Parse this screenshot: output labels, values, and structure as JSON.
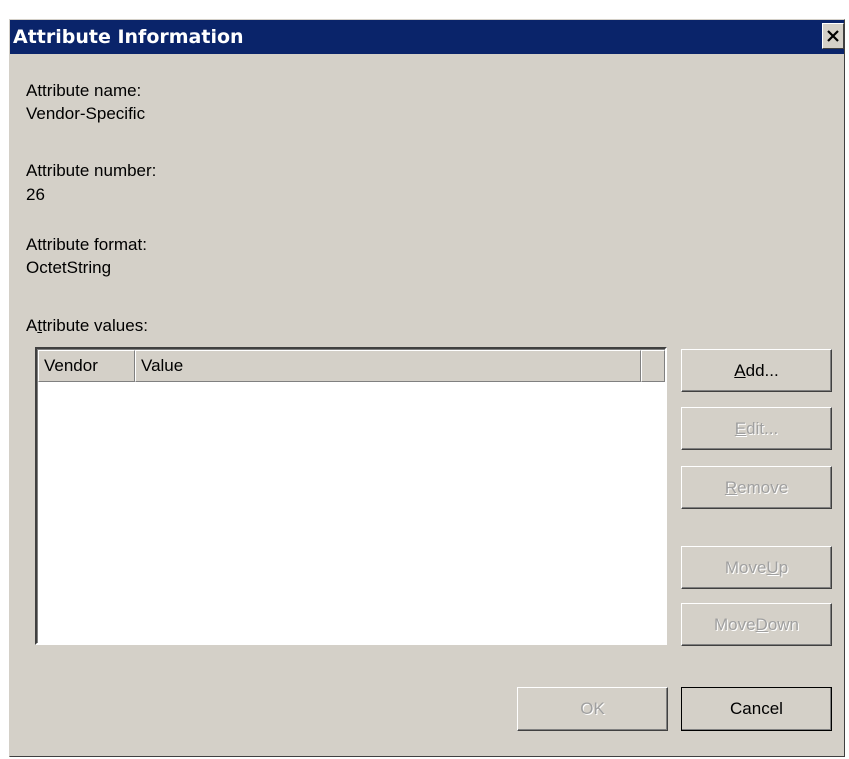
{
  "window": {
    "title": "Attribute Information",
    "close_icon": "close-icon"
  },
  "fields": {
    "name_label": "Attribute name:",
    "name_value": "Vendor-Specific",
    "number_label": "Attribute number:",
    "number_value": "26",
    "format_label": "Attribute format:",
    "format_value": "OctetString",
    "values_label_pre": "A",
    "values_label_mnemonic": "t",
    "values_label_post": "tribute values:"
  },
  "list": {
    "columns": [
      "Vendor",
      "Value"
    ],
    "rows": []
  },
  "buttons": {
    "add": {
      "pre": "",
      "mnemonic": "A",
      "post": "dd...",
      "enabled": true
    },
    "edit": {
      "pre": "",
      "mnemonic": "E",
      "post": "dit...",
      "enabled": false
    },
    "remove": {
      "pre": "",
      "mnemonic": "R",
      "post": "emove",
      "enabled": false
    },
    "move_up": {
      "pre": "Move ",
      "mnemonic": "U",
      "post": "p",
      "enabled": false
    },
    "move_down": {
      "pre": "Move ",
      "mnemonic": "D",
      "post": "own",
      "enabled": false
    },
    "ok": {
      "label": "OK",
      "enabled": false
    },
    "cancel": {
      "label": "Cancel",
      "enabled": true
    }
  },
  "colors": {
    "titlebar": "#0a246a",
    "dialog_bg": "#d4d0c8",
    "disabled_text": "#a0a0a0"
  }
}
